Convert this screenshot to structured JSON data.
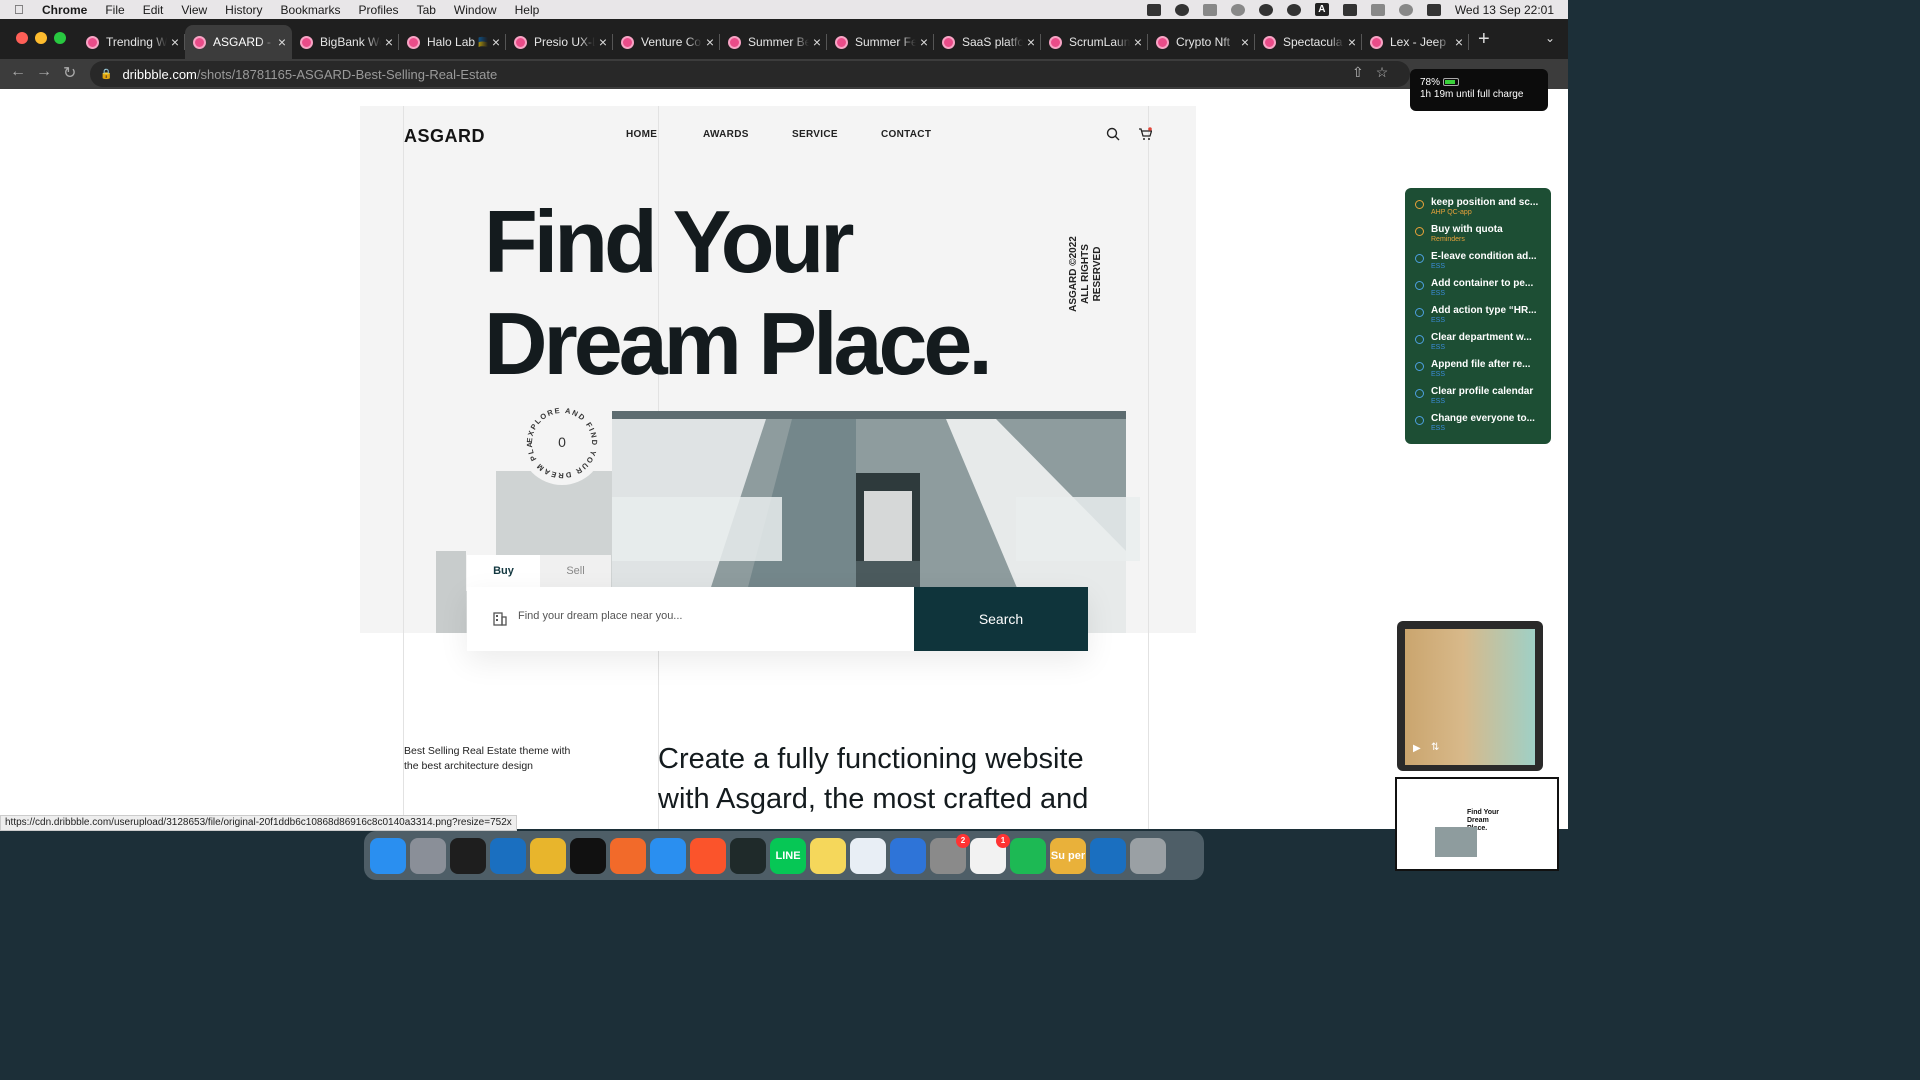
{
  "menubar": {
    "app": "Chrome",
    "menus": [
      "File",
      "Edit",
      "View",
      "History",
      "Bookmarks",
      "Profiles",
      "Tab",
      "Window",
      "Help"
    ],
    "clock": "Wed 13 Sep  22:01",
    "input_label": "A"
  },
  "tabs": [
    {
      "title": "Trending We",
      "active": false
    },
    {
      "title": "ASGARD - B",
      "active": true
    },
    {
      "title": "BigBank We",
      "active": false
    },
    {
      "title": "Halo Lab 🇺🇦",
      "active": false
    },
    {
      "title": "Presio UX-L",
      "active": false
    },
    {
      "title": "Venture Co",
      "active": false
    },
    {
      "title": "Summer Be",
      "active": false
    },
    {
      "title": "Summer Fe",
      "active": false
    },
    {
      "title": "SaaS platfo",
      "active": false
    },
    {
      "title": "ScrumLaun",
      "active": false
    },
    {
      "title": "Crypto Nft",
      "active": false
    },
    {
      "title": "Spectacula",
      "active": false
    },
    {
      "title": "Lex - Jeep",
      "active": false
    }
  ],
  "omnibox": {
    "host": "dribbble.com",
    "path": "/shots/18781165-ASGARD-Best-Selling-Real-Estate"
  },
  "site": {
    "logo": "ASGARD",
    "nav": [
      "HOME",
      "AWARDS",
      "SERVICE",
      "CONTACT"
    ],
    "hero_line1": "Find Your",
    "hero_line2": "Dream Place.",
    "vertical_line1": "ASGARD ©2022",
    "vertical_line2": "ALL RIGHTS RESERVED",
    "badge_text": "EXPLORE AND FIND YOUR DREAM PLACE",
    "badge_center": "0",
    "tab_buy": "Buy",
    "tab_sell": "Sell",
    "search_placeholder": "Find your dream place near you...",
    "search_button": "Search",
    "tagline": "Best Selling Real Estate theme with the best architecture design",
    "big_line1": "Create a fully functioning website",
    "big_line2": "with Asgard, the most crafted and"
  },
  "battery": {
    "percent": "78%",
    "status": "1h 19m until full charge"
  },
  "reminders": [
    {
      "title": "keep position and sc...",
      "list": "AHP QC-app",
      "color": "orange"
    },
    {
      "title": "Buy with quota",
      "list": "Reminders",
      "color": "orange"
    },
    {
      "title": "E-leave condition ad...",
      "list": "ESS",
      "color": "blue"
    },
    {
      "title": "Add container to pe...",
      "list": "ESS",
      "color": "blue"
    },
    {
      "title": "Add action type “HR...",
      "list": "ESS",
      "color": "blue"
    },
    {
      "title": "Clear department w...",
      "list": "ESS",
      "color": "blue"
    },
    {
      "title": "Append file after re...",
      "list": "ESS",
      "color": "blue"
    },
    {
      "title": "Clear profile calendar",
      "list": "ESS",
      "color": "blue"
    },
    {
      "title": "Change everyone to...",
      "list": "ESS",
      "color": "blue"
    }
  ],
  "preview": {
    "hero": "Find Your Dream Place."
  },
  "status_url": "https://cdn.dribbble.com/userupload/3128653/file/original-20f1ddb6c10868d86916c8c0140a3314.png?resize=752x",
  "dock": [
    {
      "name": "finder-icon",
      "color": "#2a8ff0",
      "label": ""
    },
    {
      "name": "launchpad-icon",
      "color": "#8a8f98",
      "label": ""
    },
    {
      "name": "figma-icon",
      "color": "#1e1e1e",
      "label": ""
    },
    {
      "name": "vscode-icon",
      "color": "#1a6fc0",
      "label": ""
    },
    {
      "name": "chrome-icon",
      "color": "#e8b52c",
      "label": ""
    },
    {
      "name": "terminal-icon",
      "color": "#111111",
      "label": ""
    },
    {
      "name": "sketch-pen-icon",
      "color": "#f26a2a",
      "label": ""
    },
    {
      "name": "safari-icon",
      "color": "#2a8ff0",
      "label": ""
    },
    {
      "name": "brave-icon",
      "color": "#fb542b",
      "label": ""
    },
    {
      "name": "activity-monitor-icon",
      "color": "#1f2a2a",
      "label": ""
    },
    {
      "name": "line-icon",
      "color": "#06c755",
      "label": "LINE"
    },
    {
      "name": "notes-icon",
      "color": "#f5d75b",
      "label": ""
    },
    {
      "name": "app-store-icon",
      "color": "#e8eef5",
      "label": ""
    },
    {
      "name": "xcode-icon",
      "color": "#2e74d8",
      "label": ""
    },
    {
      "name": "system-settings-icon",
      "color": "#8a8a8a",
      "label": "",
      "badge": "2"
    },
    {
      "name": "reminders-icon",
      "color": "#f2f2f2",
      "label": "",
      "badge": "1"
    },
    {
      "name": "spotify-icon",
      "color": "#1db954",
      "label": ""
    },
    {
      "name": "super-icon",
      "color": "#e9b13a",
      "label": "Su per"
    },
    {
      "name": "vscode-icon",
      "color": "#1a6fc0",
      "label": ""
    },
    {
      "name": "trash-icon",
      "color": "#9aa0a4",
      "label": ""
    }
  ]
}
